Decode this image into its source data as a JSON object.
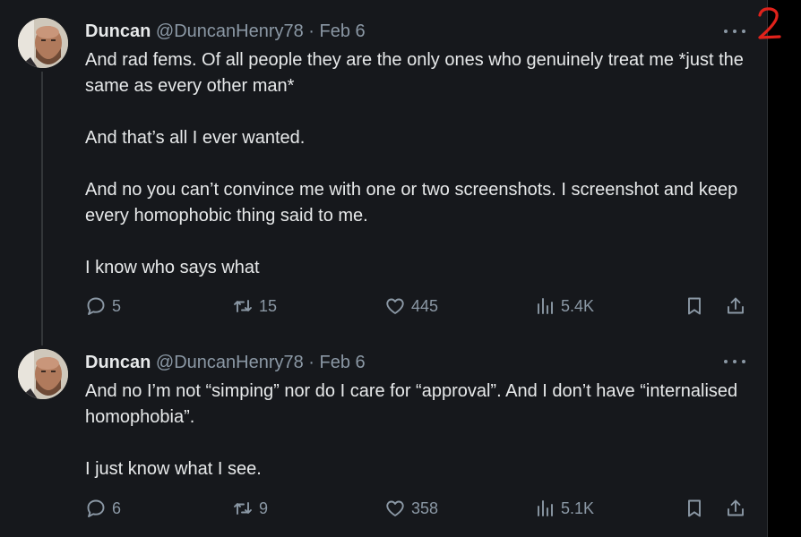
{
  "tweets": [
    {
      "author": {
        "display_name": "Duncan",
        "handle": "@DuncanHenry78",
        "separator": " · ",
        "date": "Feb 6"
      },
      "paragraphs": [
        "And rad fems. Of all people they are the only ones who genuinely treat me *just the same as every other man*",
        "And that’s all I ever wanted.",
        "And no you can’t convince me with one or two screenshots. I screenshot and keep every homophobic thing said to me.",
        "I know who says what"
      ],
      "stats": {
        "replies": "5",
        "reposts": "15",
        "likes": "445",
        "views": "5.4K"
      }
    },
    {
      "author": {
        "display_name": "Duncan",
        "handle": "@DuncanHenry78",
        "separator": " · ",
        "date": "Feb 6"
      },
      "paragraphs": [
        "And no I’m not “simping” nor do I care for “approval”. And I don’t have “internalised homophobia”.",
        "I just know what I see."
      ],
      "stats": {
        "replies": "6",
        "reposts": "9",
        "likes": "358",
        "views": "5.1K"
      }
    }
  ],
  "annotation": {
    "label": "2",
    "color": "#e0221b"
  },
  "icons": {
    "reply": "reply-icon",
    "repost": "repost-icon",
    "like": "heart-icon",
    "views": "views-icon",
    "bookmark": "bookmark-icon",
    "share": "share-icon",
    "more": "more-options-icon"
  },
  "colors": {
    "background": "#16181c",
    "text": "#e7e9ea",
    "secondary_text": "#8b98a5",
    "thread_line": "#333639"
  }
}
